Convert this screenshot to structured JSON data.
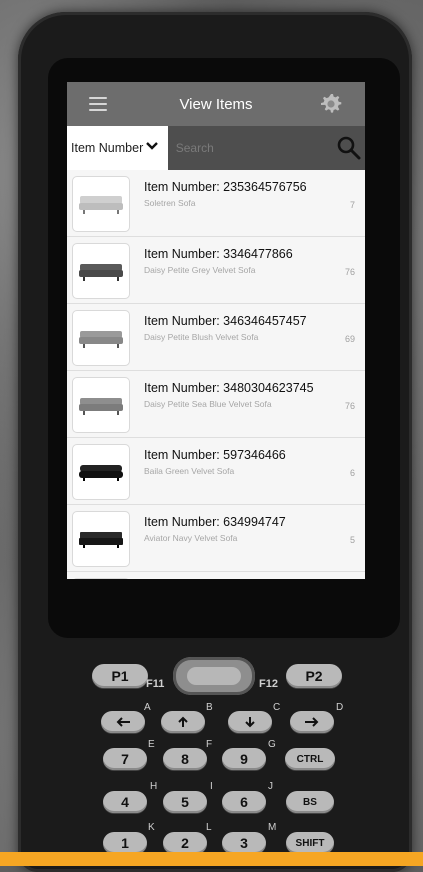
{
  "header": {
    "title": "View Items"
  },
  "search": {
    "field_selected": "Item Number",
    "placeholder": "Search"
  },
  "items": [
    {
      "item_number": "Item Number: 235364576756",
      "name": "Soletren Sofa",
      "qty": "7"
    },
    {
      "item_number": "Item Number: 3346477866",
      "name": "Daisy Petite Grey Velvet Sofa",
      "qty": "76"
    },
    {
      "item_number": "Item Number: 346346457457",
      "name": "Daisy Petite Blush Velvet Sofa",
      "qty": "69"
    },
    {
      "item_number": "Item Number: 3480304623745",
      "name": "Daisy Petite Sea Blue Velvet Sofa",
      "qty": "76"
    },
    {
      "item_number": "Item Number: 597346466",
      "name": "Baila Green Velvet Sofa",
      "qty": "6"
    },
    {
      "item_number": "Item Number: 634994747",
      "name": "Aviator Navy Velvet Sofa",
      "qty": "5"
    }
  ],
  "keypad": {
    "p1": "P1",
    "p2": "P2",
    "f11": "F11",
    "f12": "F12",
    "letters": [
      "A",
      "B",
      "C",
      "D",
      "E",
      "F",
      "G",
      "H",
      "I",
      "J",
      "K",
      "L",
      "M"
    ],
    "digits": [
      "7",
      "8",
      "9",
      "4",
      "5",
      "6",
      "1",
      "2",
      "3"
    ],
    "ctrl": "CTRL",
    "bs": "BS",
    "shift": "SHIFT"
  },
  "colors": {
    "header_bg": "#6d6d6d",
    "search_bar_bg": "#4e4e4e",
    "accent_strip": "#f6a623"
  },
  "icons": [
    "menu-icon",
    "gear-icon",
    "chevron-down-icon",
    "search-icon",
    "sofa-icon",
    "arrow-left-icon",
    "arrow-up-icon",
    "arrow-down-icon",
    "arrow-right-icon"
  ]
}
